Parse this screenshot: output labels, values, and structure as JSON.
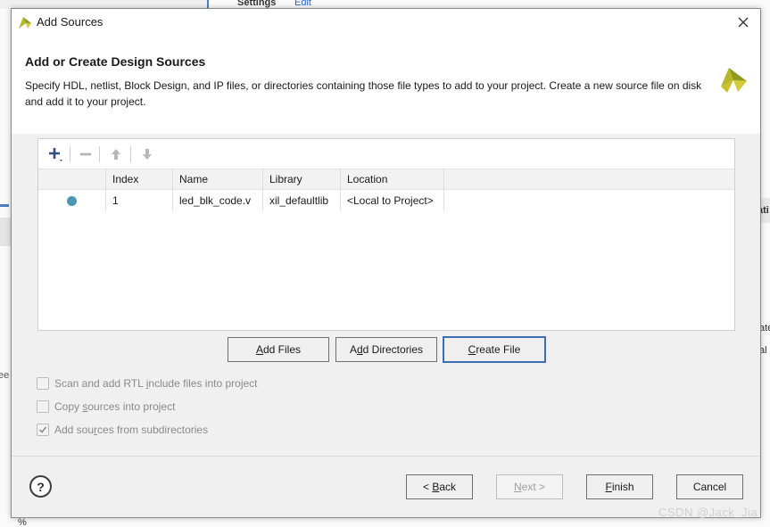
{
  "background": {
    "settings_label": "Settings",
    "edit_label": "Edit",
    "left_fragment": "ee",
    "right_fragment_1": "ati",
    "right_fragment_2": "ate",
    "right_fragment_3": "al i",
    "bottom_fragment": "%"
  },
  "dialog": {
    "title": "Add Sources",
    "heading": "Add or Create Design Sources",
    "description": "Specify HDL, netlist, Block Design, and IP files, or directories containing those file types to add to your project. Create a new source file on disk and add it to your project."
  },
  "table": {
    "columns": [
      "",
      "Index",
      "Name",
      "Library",
      "Location"
    ],
    "rows": [
      {
        "index": "1",
        "name": "led_blk_code.v",
        "library": "xil_defaultlib",
        "location": "<Local to Project>"
      }
    ]
  },
  "actions": {
    "add_files": {
      "pre": "",
      "key": "A",
      "post": "dd Files"
    },
    "add_directories": {
      "pre": "A",
      "key": "d",
      "post": "d Directories"
    },
    "create_file": {
      "pre": "",
      "key": "C",
      "post": "reate File"
    }
  },
  "options": [
    {
      "pre": "Scan and add RTL ",
      "key": "i",
      "post": "nclude files into project",
      "checked": false
    },
    {
      "pre": "Copy ",
      "key": "s",
      "post": "ources into project",
      "checked": false
    },
    {
      "pre": "Add sou",
      "key": "r",
      "post": "ces from subdirectories",
      "checked": true
    }
  ],
  "footer": {
    "help": "?",
    "back": {
      "pre": "< ",
      "key": "B",
      "post": "ack"
    },
    "next": {
      "pre": "",
      "key": "N",
      "post": "ext >"
    },
    "finish": {
      "pre": "",
      "key": "F",
      "post": "inish"
    },
    "cancel": "Cancel"
  },
  "watermark": "CSDN @Jack_Jia",
  "colors": {
    "accent": "#3b6fb5",
    "status_dot": "#4c97b7",
    "logo_yellow": "#b5b82a"
  }
}
